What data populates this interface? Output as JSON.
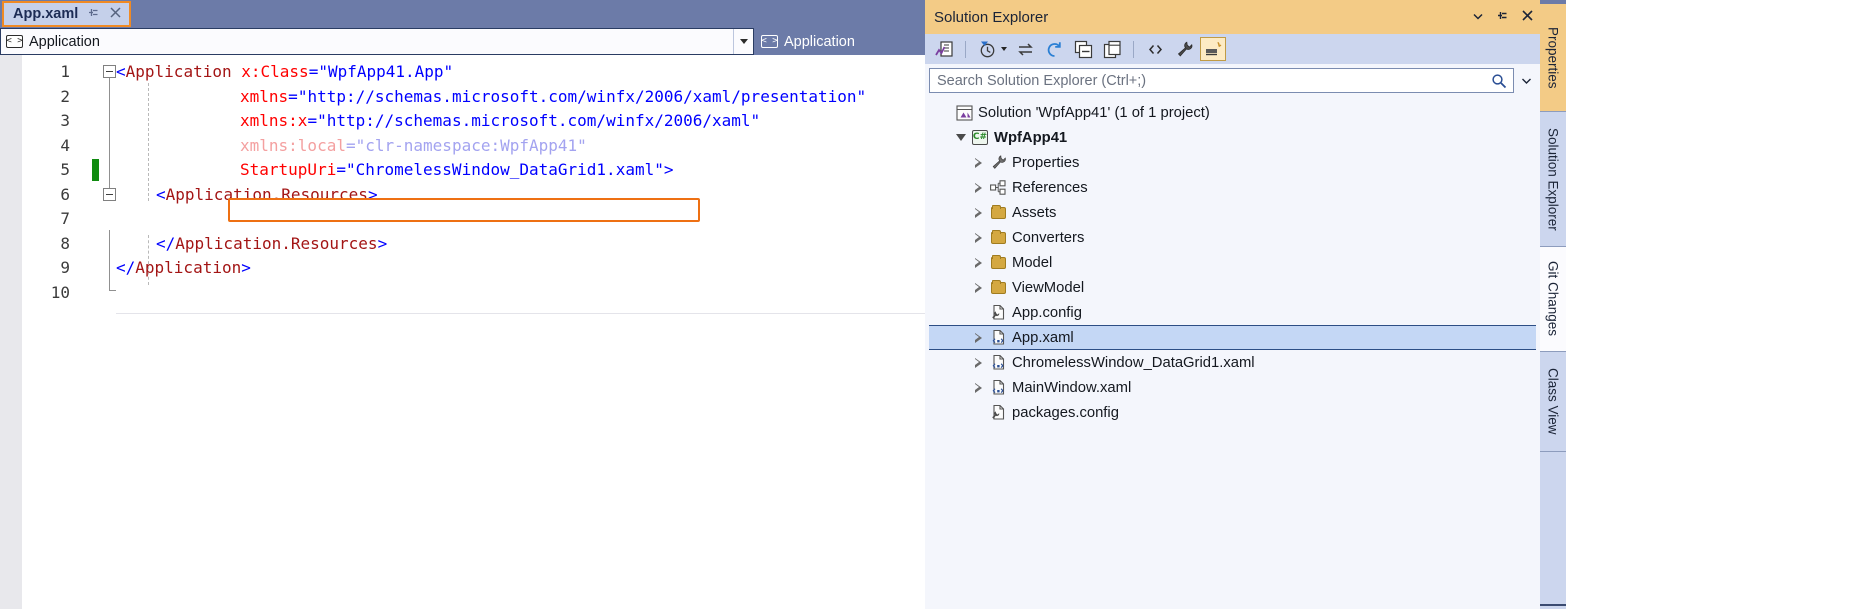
{
  "document_tab": {
    "label": "App.xaml",
    "pin_icon": "pin-icon",
    "close_icon": "close-icon",
    "accent_color": "#f08a24"
  },
  "navigation_bar": {
    "left_label": "Application",
    "left_icon": "code-element-icon",
    "right_label": "Application",
    "right_icon": "code-element-icon",
    "dropdown_icon": "chevron-down-icon"
  },
  "editor": {
    "language": "xaml",
    "total_lines": 10,
    "lines": [
      {
        "n": "1",
        "changed": false,
        "fold": "open",
        "indent": 0
      },
      {
        "n": "2",
        "changed": false,
        "fold": "none",
        "indent": 0
      },
      {
        "n": "3",
        "changed": false,
        "fold": "none",
        "indent": 0
      },
      {
        "n": "4",
        "changed": false,
        "fold": "none",
        "indent": 0
      },
      {
        "n": "5",
        "changed": true,
        "fold": "none",
        "indent": 0
      },
      {
        "n": "6",
        "changed": false,
        "fold": "open",
        "indent": 0
      },
      {
        "n": "7",
        "changed": false,
        "fold": "none",
        "indent": 0
      },
      {
        "n": "8",
        "changed": false,
        "fold": "none",
        "indent": 0
      },
      {
        "n": "9",
        "changed": false,
        "fold": "none",
        "indent": 0
      },
      {
        "n": "10",
        "changed": false,
        "fold": "none",
        "indent": 0
      }
    ],
    "code_text": {
      "l1": "<Application x:Class=\"WpfApp41.App\"",
      "l2": "xmlns=\"http://schemas.microsoft.com/winfx/2006/xaml/presentation\"",
      "l3": "xmlns:x=\"http://schemas.microsoft.com/winfx/2006/xaml\"",
      "l4": "xmlns:local=\"clr-namespace:WpfApp41\"",
      "l5": "StartupUri=\"ChromelessWindow_DataGrid1.xaml\">",
      "l6": "<Application.Resources>",
      "l7": "",
      "l8": "</Application.Resources>",
      "l9": "</Application>",
      "l10": ""
    },
    "annotation": {
      "type": "rectangle-highlight",
      "target_line": "5",
      "color": "#ee7013"
    },
    "change_marker_color": "#108b10"
  },
  "solution_explorer": {
    "title": "Solution Explorer",
    "title_bar_color": "#f3cb86",
    "title_buttons": [
      {
        "name": "dropdown-icon",
        "glyph": "▾"
      },
      {
        "name": "pin-icon",
        "glyph": "⊣"
      },
      {
        "name": "close-icon",
        "glyph": "✕"
      }
    ],
    "toolbar_icons": [
      {
        "name": "code-map-icon",
        "label": "Code Map"
      },
      {
        "name": "pending-changes-icon",
        "label": "Pending Changes Filter",
        "has_caret": true
      },
      {
        "name": "sync-with-active-document-icon",
        "label": "Sync with Active Document"
      },
      {
        "name": "refresh-icon",
        "label": "Refresh"
      },
      {
        "name": "collapse-all-icon",
        "label": "Collapse All"
      },
      {
        "name": "new-solution-view-icon",
        "label": "New Solution Explorer View"
      },
      {
        "name": "show-all-files-icon",
        "label": "Show All Files"
      },
      {
        "name": "properties-icon",
        "label": "Properties"
      },
      {
        "name": "preview-selected-items-icon",
        "label": "Preview Selected Items",
        "active": true
      }
    ],
    "search": {
      "placeholder": "Search Solution Explorer (Ctrl+;)",
      "value": "",
      "icon": "search-icon",
      "dropdown_icon": "chevron-down-icon"
    },
    "tree": [
      {
        "label": "Solution 'WpfApp41' (1 of 1 project)",
        "icon": "solution-icon",
        "indent": 0,
        "expander": "none",
        "bold": false,
        "selected": false
      },
      {
        "label": "WpfApp41",
        "icon": "csharp-project-icon",
        "indent": 1,
        "expander": "expanded",
        "bold": true,
        "selected": false
      },
      {
        "label": "Properties",
        "icon": "wrench-icon",
        "indent": 2,
        "expander": "collapsed",
        "bold": false,
        "selected": false
      },
      {
        "label": "References",
        "icon": "references-icon",
        "indent": 2,
        "expander": "collapsed",
        "bold": false,
        "selected": false
      },
      {
        "label": "Assets",
        "icon": "folder-icon",
        "indent": 2,
        "expander": "collapsed",
        "bold": false,
        "selected": false
      },
      {
        "label": "Converters",
        "icon": "folder-icon",
        "indent": 2,
        "expander": "collapsed",
        "bold": false,
        "selected": false
      },
      {
        "label": "Model",
        "icon": "folder-icon",
        "indent": 2,
        "expander": "collapsed",
        "bold": false,
        "selected": false
      },
      {
        "label": "ViewModel",
        "icon": "folder-icon",
        "indent": 2,
        "expander": "collapsed",
        "bold": false,
        "selected": false
      },
      {
        "label": "App.config",
        "icon": "config-file-icon",
        "indent": 2,
        "expander": "none",
        "bold": false,
        "selected": false
      },
      {
        "label": "App.xaml",
        "icon": "xaml-file-icon",
        "indent": 2,
        "expander": "collapsed",
        "bold": false,
        "selected": true
      },
      {
        "label": "ChromelessWindow_DataGrid1.xaml",
        "icon": "xaml-file-icon",
        "indent": 2,
        "expander": "collapsed",
        "bold": false,
        "selected": false
      },
      {
        "label": "MainWindow.xaml",
        "icon": "xaml-file-icon",
        "indent": 2,
        "expander": "collapsed",
        "bold": false,
        "selected": false
      },
      {
        "label": "packages.config",
        "icon": "config-file-icon",
        "indent": 2,
        "expander": "none",
        "bold": false,
        "selected": false
      }
    ],
    "selection_color": "#c4d7f5"
  },
  "vertical_tabs": [
    {
      "label": "Properties",
      "active": false
    },
    {
      "label": "Solution Explorer",
      "active": true
    },
    {
      "label": "Git Changes",
      "active": false
    },
    {
      "label": "Class View",
      "active": false
    }
  ]
}
